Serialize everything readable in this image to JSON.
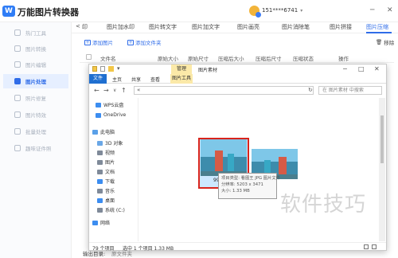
{
  "app": {
    "logo_text": "W",
    "title": "万能图片转换器",
    "username": "151****6741",
    "window_controls": [
      "─",
      "✕"
    ]
  },
  "sidebar": {
    "items": [
      {
        "label": "热门工具",
        "active": false
      },
      {
        "label": "图片转换",
        "active": false
      },
      {
        "label": "图片编辑",
        "active": false
      },
      {
        "label": "图片处理",
        "active": true
      },
      {
        "label": "照片修复",
        "active": false
      },
      {
        "label": "图片特效",
        "active": false
      },
      {
        "label": "批量处理",
        "active": false
      },
      {
        "label": "趣味证件照",
        "active": false
      }
    ]
  },
  "tabs": {
    "back": "<",
    "items": [
      "印",
      "图片加水印",
      "图片转文字",
      "图片加文字",
      "图片画亮",
      "图片消除笔",
      "图片拼接",
      "图片压缩"
    ],
    "active_index": 7
  },
  "toolbar": {
    "add_image": "添加图片",
    "add_folder": "添加文件夹",
    "remove": "移除"
  },
  "table": {
    "headers": [
      "文件名",
      "原始大小",
      "原始尺寸",
      "压缩后大小",
      "压缩后尺寸",
      "压缩状态",
      "操作"
    ]
  },
  "bottom": {
    "output_label": "输出目录:",
    "output_value": "原文件夹"
  },
  "explorer": {
    "quick_access": "▾",
    "context_label": "管理",
    "path_title": "图片素材",
    "controls": [
      "─",
      "□",
      "✕"
    ],
    "ribbon_tabs": [
      "文件",
      "主页",
      "共享",
      "查看",
      "图片工具"
    ],
    "nav_buttons": [
      "←",
      "→",
      "∨",
      "↑"
    ],
    "address": "«",
    "refresh": "↻",
    "search_placeholder": "在 图片素材 中搜索",
    "nav_items": [
      {
        "label": "WPS云盘",
        "color": "#3c8df0"
      },
      {
        "label": "OneDrive",
        "color": "#3c8df0"
      },
      {
        "label": "此电脑",
        "color": "#5aa0e8"
      },
      {
        "label": "3D 对象",
        "color": "#6aa7e6"
      },
      {
        "label": "视频",
        "color": "#7f8a99"
      },
      {
        "label": "图片",
        "color": "#7f8a99"
      },
      {
        "label": "文档",
        "color": "#7f8a99"
      },
      {
        "label": "下载",
        "color": "#3c8df0"
      },
      {
        "label": "音乐",
        "color": "#7f8a99"
      },
      {
        "label": "桌面",
        "color": "#3c8df0"
      },
      {
        "label": "系统 (C:)",
        "color": "#7f8a99"
      },
      {
        "label": "网络",
        "color": "#3c8df0"
      }
    ],
    "selected_label": "99",
    "tooltip": {
      "type": "项目类型: 看图王 JPG 图片文件",
      "resolution": "分辨率: 5203 x 3471",
      "size": "大小: 1.33 MB"
    },
    "status": {
      "count": "79 个项目",
      "selected": "选中 1 个项目  1.33 MB"
    }
  },
  "watermark": "软件技巧"
}
